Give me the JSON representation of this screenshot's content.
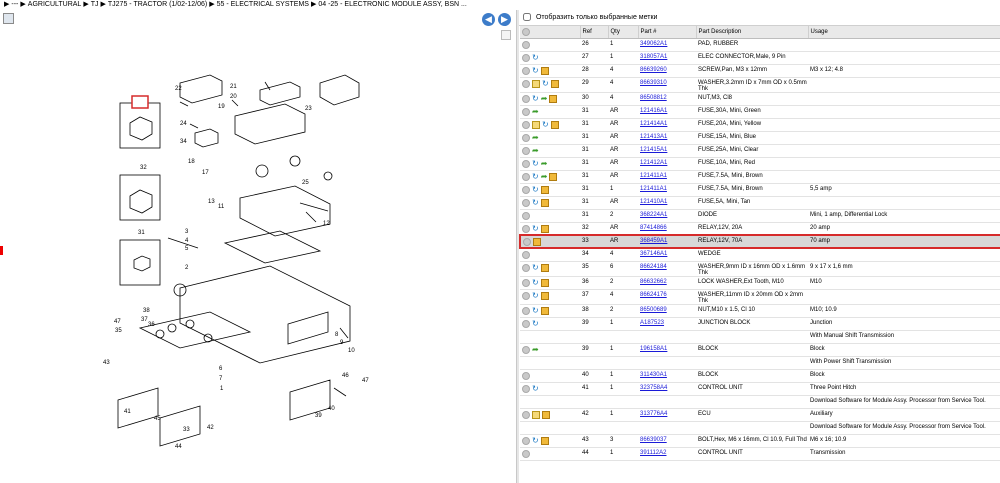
{
  "breadcrumb": [
    "---",
    "AGRICULTURAL",
    "TJ",
    "TJ275 - TRACTOR (1/02-12/06)",
    "55 - ELECTRICAL SYSTEMS",
    "04 -25 - ELECTRONIC MODULE ASSY, BSN ..."
  ],
  "filter_label": "Отобразить только выбранные метки",
  "columns": [
    "Ref",
    "Qty",
    "Part #",
    "Part Description",
    "Usage"
  ],
  "rows": [
    {
      "icons": [
        "circle"
      ],
      "ref": "26",
      "qty": "1",
      "part": "349062A1",
      "desc": "PAD, RUBBER",
      "usage": ""
    },
    {
      "icons": [
        "circle",
        "blue"
      ],
      "ref": "27",
      "qty": "1",
      "part": "318057A1",
      "desc": "ELEC CONNECTOR,Male, 9 Pin",
      "usage": ""
    },
    {
      "icons": [
        "circle",
        "blue",
        "box"
      ],
      "ref": "28",
      "qty": "4",
      "part": "86639260",
      "desc": "SCREW,Pan, M3 x 12mm",
      "usage": "M3 x 12; 4.8"
    },
    {
      "icons": [
        "circle",
        "doc",
        "blue",
        "box"
      ],
      "ref": "29",
      "qty": "4",
      "part": "86639310",
      "desc": "WASHER,3.2mm ID x 7mm OD x 0.5mm Thk",
      "usage": ""
    },
    {
      "icons": [
        "circle",
        "blue",
        "green",
        "box"
      ],
      "ref": "30",
      "qty": "4",
      "part": "86508812",
      "desc": "NUT,M3, Cl8",
      "usage": ""
    },
    {
      "icons": [
        "circle",
        "green"
      ],
      "ref": "31",
      "qty": "AR",
      "part": "121416A1",
      "desc": "FUSE,30A, Mini, Green",
      "usage": ""
    },
    {
      "icons": [
        "circle",
        "doc",
        "blue",
        "box"
      ],
      "ref": "31",
      "qty": "AR",
      "part": "121414A1",
      "desc": "FUSE,20A, Mini, Yellow",
      "usage": ""
    },
    {
      "icons": [
        "circle",
        "green"
      ],
      "ref": "31",
      "qty": "AR",
      "part": "121413A1",
      "desc": "FUSE,15A, Mini, Blue",
      "usage": ""
    },
    {
      "icons": [
        "circle",
        "green"
      ],
      "ref": "31",
      "qty": "AR",
      "part": "121415A1",
      "desc": "FUSE,25A, Mini, Clear",
      "usage": ""
    },
    {
      "icons": [
        "circle",
        "blue",
        "green"
      ],
      "ref": "31",
      "qty": "AR",
      "part": "121412A1",
      "desc": "FUSE,10A, Mini, Red",
      "usage": ""
    },
    {
      "icons": [
        "circle",
        "blue",
        "green",
        "box"
      ],
      "ref": "31",
      "qty": "AR",
      "part": "121411A1",
      "desc": "FUSE,7.5A, Mini, Brown",
      "usage": ""
    },
    {
      "icons": [
        "circle",
        "blue",
        "box"
      ],
      "ref": "31",
      "qty": "1",
      "part": "121411A1",
      "desc": "FUSE,7.5A, Mini, Brown",
      "usage": "5,5 amp"
    },
    {
      "icons": [
        "circle",
        "blue",
        "box"
      ],
      "ref": "31",
      "qty": "AR",
      "part": "121410A1",
      "desc": "FUSE,5A, Mini, Tan",
      "usage": ""
    },
    {
      "icons": [
        "circle"
      ],
      "ref": "31",
      "qty": "2",
      "part": "368224A1",
      "desc": "DIODE",
      "usage": "Mini, 1 amp, Differential Lock"
    },
    {
      "icons": [
        "circle",
        "blue",
        "box"
      ],
      "ref": "32",
      "qty": "AR",
      "part": "87414866",
      "desc": "RELAY,12V, 20A",
      "usage": "20 amp"
    },
    {
      "icons": [
        "circle",
        "box"
      ],
      "ref": "33",
      "qty": "AR",
      "part": "368459A1",
      "desc": "RELAY,12V, 70A",
      "usage": "70 amp",
      "hl": true
    },
    {
      "icons": [
        "circle"
      ],
      "ref": "34",
      "qty": "4",
      "part": "367146A1",
      "desc": "WEDGE",
      "usage": ""
    },
    {
      "icons": [
        "circle",
        "blue",
        "box"
      ],
      "ref": "35",
      "qty": "6",
      "part": "86624184",
      "desc": "WASHER,9mm ID x 16mm OD x 1.6mm Thk",
      "usage": "9 x 17 x 1,6 mm"
    },
    {
      "icons": [
        "circle",
        "blue",
        "box"
      ],
      "ref": "36",
      "qty": "2",
      "part": "86632662",
      "desc": "LOCK WASHER,Ext Tooth, M10",
      "usage": "M10"
    },
    {
      "icons": [
        "circle",
        "blue",
        "box"
      ],
      "ref": "37",
      "qty": "4",
      "part": "86624176",
      "desc": "WASHER,11mm ID x 20mm OD x 2mm Thk",
      "usage": ""
    },
    {
      "icons": [
        "circle",
        "blue",
        "box"
      ],
      "ref": "38",
      "qty": "2",
      "part": "86500689",
      "desc": "NUT,M10 x 1.5, Cl 10",
      "usage": "M10; 10.9"
    },
    {
      "icons": [
        "circle",
        "blue"
      ],
      "ref": "39",
      "qty": "1",
      "part": "A187523",
      "desc": "JUNCTION BLOCK",
      "usage": "Junction"
    },
    {
      "icons": [],
      "ref": "",
      "qty": "",
      "part": "",
      "desc": "",
      "usage": "With Manual Shift Transmission"
    },
    {
      "icons": [
        "circle",
        "green"
      ],
      "ref": "39",
      "qty": "1",
      "part": "196158A1",
      "desc": "BLOCK",
      "usage": "Block"
    },
    {
      "icons": [],
      "ref": "",
      "qty": "",
      "part": "",
      "desc": "",
      "usage": "With Power Shift Transmission"
    },
    {
      "icons": [
        "circle"
      ],
      "ref": "40",
      "qty": "1",
      "part": "311430A1",
      "desc": "BLOCK",
      "usage": "Block"
    },
    {
      "icons": [
        "circle",
        "blue"
      ],
      "ref": "41",
      "qty": "1",
      "part": "323758A4",
      "desc": "CONTROL UNIT",
      "usage": "Three Point Hitch"
    },
    {
      "icons": [],
      "ref": "",
      "qty": "",
      "part": "",
      "desc": "",
      "usage": "Download Software for Module Assy. Processor from Service Tool."
    },
    {
      "icons": [
        "circle",
        "doc",
        "box"
      ],
      "ref": "42",
      "qty": "1",
      "part": "313776A4",
      "desc": "ECU",
      "usage": "Auxiliary"
    },
    {
      "icons": [],
      "ref": "",
      "qty": "",
      "part": "",
      "desc": "",
      "usage": "Download Software for Module Assy. Processor from Service Tool."
    },
    {
      "icons": [
        "circle",
        "blue",
        "box"
      ],
      "ref": "43",
      "qty": "3",
      "part": "86639037",
      "desc": "BOLT,Hex, M6 x 16mm, Cl 10.9, Full Thd",
      "usage": "M6 x 16; 10.9"
    },
    {
      "icons": [
        "circle"
      ],
      "ref": "44",
      "qty": "1",
      "part": "391112A2",
      "desc": "CONTROL UNIT",
      "usage": "Transmission"
    }
  ],
  "diagram_labels": [
    "22",
    "21",
    "20",
    "19",
    "23",
    "24",
    "33",
    "34",
    "18",
    "17",
    "25",
    "12",
    "26",
    "11",
    "13",
    "32",
    "31",
    "3",
    "4",
    "5",
    "2",
    "6",
    "7",
    "10",
    "9",
    "8",
    "38",
    "37",
    "36",
    "35",
    "39",
    "40",
    "41",
    "42",
    "43",
    "44",
    "45",
    "46",
    "47",
    "1"
  ]
}
